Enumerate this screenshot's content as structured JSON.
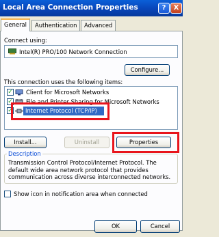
{
  "window": {
    "title": "Local Area Connection Properties"
  },
  "title_buttons": {
    "help": "?",
    "close": "X"
  },
  "tabs": [
    {
      "label": "General",
      "active": true
    },
    {
      "label": "Authentication",
      "active": false
    },
    {
      "label": "Advanced",
      "active": false
    }
  ],
  "connect_using": {
    "label": "Connect using:",
    "adapter": "Intel(R) PRO/100 Network Connection",
    "configure_label": "Configure..."
  },
  "items_section": {
    "label": "This connection uses the following items:",
    "items": [
      {
        "label": "Client for Microsoft Networks",
        "checked": true
      },
      {
        "label": "File and Printer Sharing for Microsoft Networks",
        "checked": true
      },
      {
        "label": "Internet Protocol (TCP/IP)",
        "checked": true,
        "selected": true
      }
    ]
  },
  "buttons": {
    "install": "Install...",
    "uninstall": "Uninstall",
    "properties": "Properties",
    "ok": "OK",
    "cancel": "Cancel"
  },
  "description": {
    "label": "Description",
    "text": "Transmission Control Protocol/Internet Protocol. The default wide area network protocol that provides communication across diverse interconnected networks."
  },
  "show_icon": {
    "label": "Show icon in notification area when connected",
    "checked": false
  },
  "colors": {
    "titlebar": "#0845b8",
    "selection": "#316ac5",
    "callout": "#e8141c",
    "face": "#ece9d8"
  }
}
